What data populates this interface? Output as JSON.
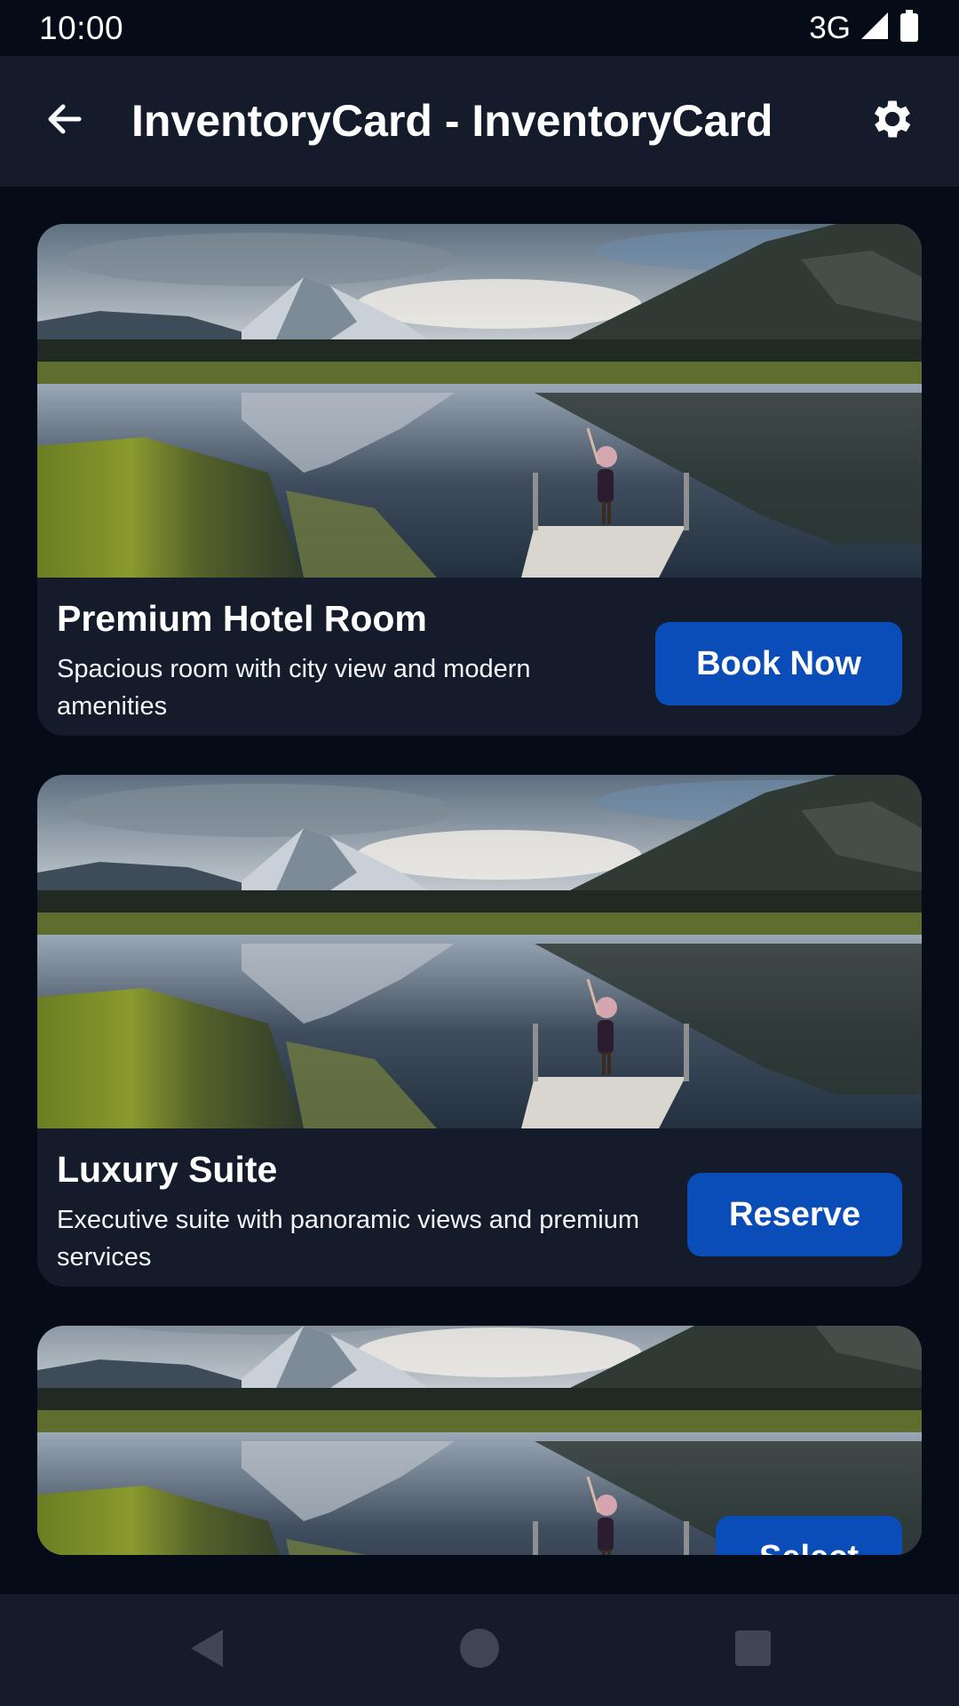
{
  "status_bar": {
    "time": "10:00",
    "network": "3G"
  },
  "app_bar": {
    "title": "InventoryCard - InventoryCard"
  },
  "cards": [
    {
      "title": "Premium Hotel Room",
      "description": "Spacious room with city view and modern amenities",
      "button_label": "Book Now"
    },
    {
      "title": "Luxury Suite",
      "description": "Executive suite with panoramic views and premium services",
      "button_label": "Reserve"
    },
    {
      "title": "",
      "description": "",
      "button_label": "Select"
    }
  ],
  "colors": {
    "background": "#050b17",
    "surface": "#141c2b",
    "accent_button": "#0b4db8",
    "text": "#ffffff"
  },
  "icons": {
    "back": "arrow-back-icon",
    "settings": "gear-icon",
    "nav_back": "triangle-back-icon",
    "nav_home": "circle-home-icon",
    "nav_recents": "square-recents-icon"
  }
}
